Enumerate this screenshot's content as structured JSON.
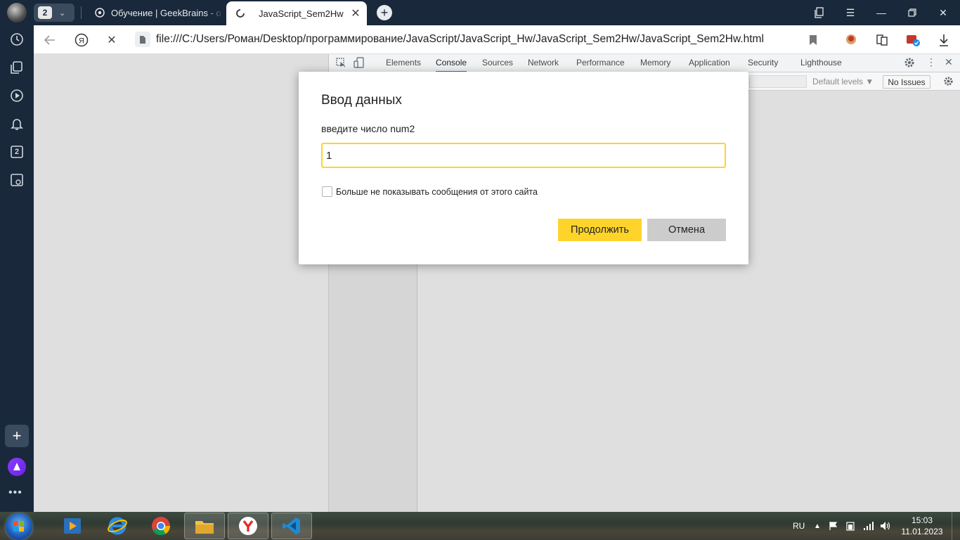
{
  "browser": {
    "tab_count": "2",
    "tabs": [
      {
        "title": "Обучение | GeekBrains - о",
        "active": false
      },
      {
        "title": "JavaScript_Sem2Hw",
        "active": true
      }
    ],
    "address": "file:///C:/Users/Роман/Desktop/программирование/JavaScript/JavaScript_Hw/JavaScript_Sem2Hw/JavaScript_Sem2Hw.html",
    "sidebar_badge": "2"
  },
  "devtools": {
    "tabs": [
      "Elements",
      "Console",
      "Sources",
      "Network",
      "Performance",
      "Memory",
      "Application",
      "Security",
      "Lighthouse"
    ],
    "active_tab": "Console",
    "default_levels": "Default levels ▼",
    "no_issues": "No Issues"
  },
  "dialog": {
    "title": "Ввод данных",
    "message": "введите число num2",
    "input_value": "1",
    "checkbox_label": "Больше не показывать сообщения от этого сайта",
    "ok_label": "Продолжить",
    "cancel_label": "Отмена"
  },
  "taskbar": {
    "language": "RU",
    "time": "15:03",
    "date": "11.01.2023"
  },
  "colors": {
    "accent_yellow": "#fed42b",
    "chrome_dark": "#19283a",
    "devtools_active_blue": "#1a73e8"
  }
}
